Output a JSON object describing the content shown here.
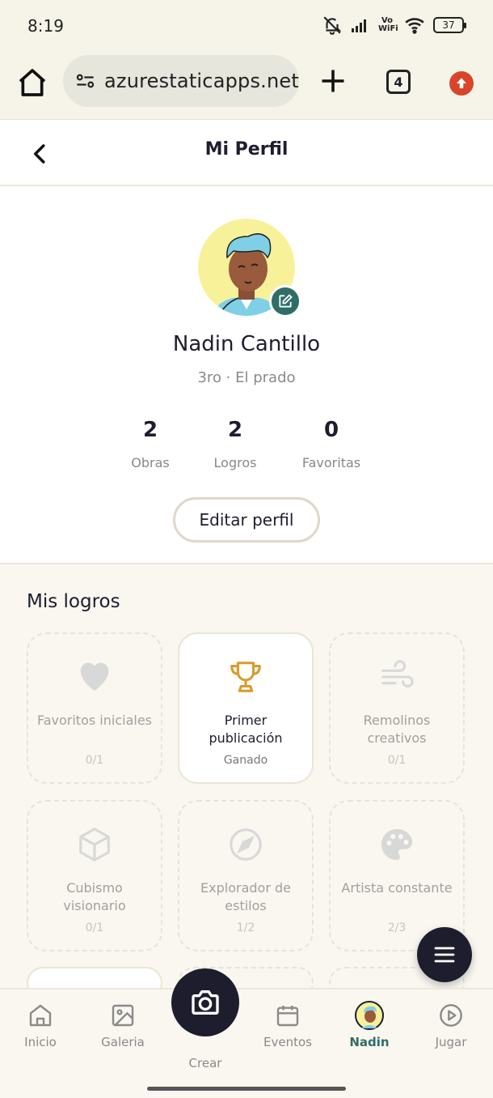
{
  "status_bar": {
    "time": "8:19",
    "network": "Vo WiFi",
    "battery": "37"
  },
  "browser": {
    "url": "azurestaticapps.net",
    "tab_count": "4"
  },
  "header": {
    "title": "Mi Perfil"
  },
  "profile": {
    "name": "Nadin Cantillo",
    "subtitle": "3ro · El prado",
    "stats": [
      {
        "value": "2",
        "label": "Obras"
      },
      {
        "value": "2",
        "label": "Logros"
      },
      {
        "value": "0",
        "label": "Favoritas"
      }
    ],
    "edit_button": "Editar perfil"
  },
  "achievements": {
    "title": "Mis logros",
    "items": [
      {
        "name": "Favoritos iniciales",
        "progress": "0/1",
        "icon": "heart-icon",
        "earned": false
      },
      {
        "name": "Primer publicación",
        "progress": "Ganado",
        "icon": "trophy-icon",
        "earned": true
      },
      {
        "name": "Remolinos creativos",
        "progress": "0/1",
        "icon": "wind-icon",
        "earned": false
      },
      {
        "name": "Cubismo visionario",
        "progress": "0/1",
        "icon": "cube-icon",
        "earned": false
      },
      {
        "name": "Explorador de estilos",
        "progress": "1/2",
        "icon": "compass-icon",
        "earned": false
      },
      {
        "name": "Artista constante",
        "progress": "2/3",
        "icon": "palette-icon",
        "earned": false
      }
    ]
  },
  "nav": {
    "items": [
      {
        "label": "Inicio",
        "icon": "home-icon"
      },
      {
        "label": "Galeria",
        "icon": "image-icon"
      },
      {
        "label": "Crear",
        "icon": "camera-icon"
      },
      {
        "label": "Eventos",
        "icon": "calendar-icon"
      },
      {
        "label": "Nadin",
        "icon": "avatar-icon"
      },
      {
        "label": "Jugar",
        "icon": "play-icon"
      }
    ]
  },
  "colors": {
    "accent": "#2e6e66",
    "dark": "#1d1d2e",
    "background": "#faf7f0",
    "trophy": "#d99a2b"
  }
}
